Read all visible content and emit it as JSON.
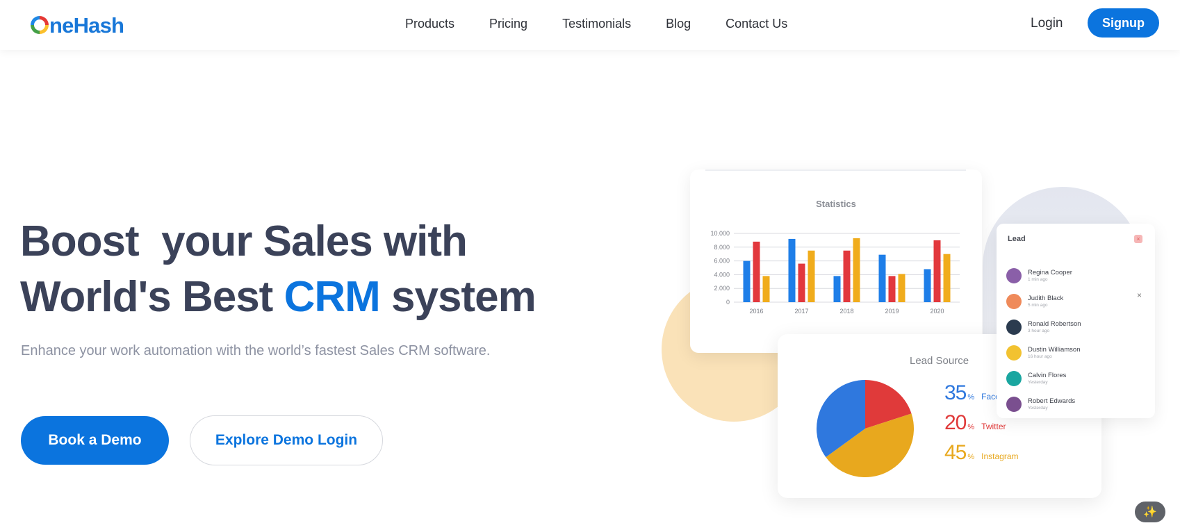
{
  "header": {
    "logo_first": "O",
    "logo_mid": "ne",
    "logo_rest": "Hash",
    "nav": [
      "Products",
      "Pricing",
      "Testimonials",
      "Blog",
      "Contact Us"
    ],
    "login": "Login",
    "signup": "Signup"
  },
  "hero": {
    "line1": "Boost  your Sales with",
    "line2_a": "World's Best ",
    "line2_hl": "CRM",
    "line2_b": " system",
    "subtitle": "Enhance your work automation with the world’s fastest Sales CRM software.",
    "btn_demo": "Book a Demo",
    "btn_explore": "Explore Demo Login"
  },
  "statistics": {
    "title": "Statistics",
    "chart_data": {
      "type": "bar",
      "categories": [
        "2016",
        "2017",
        "2018",
        "2019",
        "2020"
      ],
      "series": [
        {
          "values": [
            6000,
            9200,
            3800,
            6900,
            4800
          ],
          "color": "#1e7ee8"
        },
        {
          "values": [
            8800,
            5600,
            7500,
            3800,
            9000
          ],
          "color": "#e2383d"
        },
        {
          "values": [
            3800,
            7500,
            9300,
            4100,
            7000
          ],
          "color": "#f0ac1c"
        }
      ],
      "y_ticks": [
        "10.000",
        "8.000",
        "6.000",
        "4.000",
        "2.000",
        "0"
      ],
      "ylim": [
        0,
        10000
      ]
    }
  },
  "lead": {
    "title": "Lead",
    "badge": "×",
    "close": "×",
    "items": [
      {
        "name": "Regina Cooper",
        "time": "1 min ago",
        "color": "#8a5fa8"
      },
      {
        "name": "Judith Black",
        "time": "5 min ago",
        "color": "#ef8a5a"
      },
      {
        "name": "Ronald Robertson",
        "time": "3 hour ago",
        "color": "#2b3b4f"
      },
      {
        "name": "Dustin Williamson",
        "time": "16 hour ago",
        "color": "#f2c230"
      },
      {
        "name": "Calvin Flores",
        "time": "Yesterday",
        "color": "#1aa6a0"
      },
      {
        "name": "Robert Edwards",
        "time": "Yesterday",
        "color": "#7a4f8f"
      }
    ]
  },
  "lead_source": {
    "title": "Lead Source",
    "chart_data": {
      "type": "pie",
      "slices": [
        {
          "label": "Facebook",
          "value": 35,
          "color": "#2f78de"
        },
        {
          "label": "Twitter",
          "value": 20,
          "color": "#e03a3a"
        },
        {
          "label": "Instagram",
          "value": 45,
          "color": "#e8a81e"
        }
      ]
    },
    "rows": [
      {
        "pct": "35",
        "sign": "%",
        "label": "Face",
        "color": "#2f78de"
      },
      {
        "pct": "20",
        "sign": "%",
        "label": "Twitter",
        "color": "#e03a3a"
      },
      {
        "pct": "45",
        "sign": "%",
        "label": "Instagram",
        "color": "#e8a81e"
      }
    ]
  },
  "magic_icon": "✨"
}
